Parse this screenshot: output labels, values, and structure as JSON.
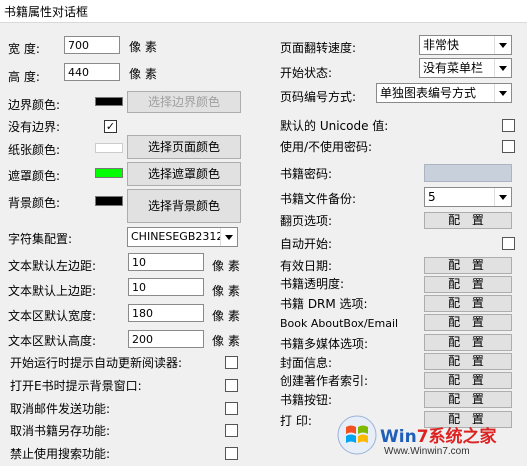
{
  "window_title": "书籍属性对话框",
  "left": {
    "width_label": "宽  度:",
    "width_value": "700",
    "width_unit": "像 素",
    "height_label": "高  度:",
    "height_value": "440",
    "height_unit": "像 素",
    "border_color_label": "边界颜色:",
    "border_color_button": "选择边界颜色",
    "no_border_label": "没有边界:",
    "no_border_checked": "✓",
    "paper_color_label": "纸张颜色:",
    "paper_color_button": "选择页面颜色",
    "mask_color_label": "遮罩颜色:",
    "mask_color_button": "选择遮罩颜色",
    "bg_color_label": "背景颜色:",
    "bg_color_button": "选择背景颜色",
    "charset_label": "字符集配置:",
    "charset_value": "CHINESEGB2312",
    "text_left_label": "文本默认左边距:",
    "text_left_value": "10",
    "text_top_label": "文本默认上边距:",
    "text_top_value": "10",
    "text_width_label": "文本区默认宽度:",
    "text_width_value": "180",
    "text_height_label": "文本区默认高度:",
    "text_height_value": "200",
    "px_unit": "像 素",
    "opt_auto_update": "开始运行时提示自动更新阅读器:",
    "opt_show_bg": "打开E书时提示背景窗口:",
    "opt_cancel_mail": "取消邮件发送功能:",
    "opt_cancel_saveas": "取消书籍另存功能:",
    "opt_disable_search": "禁止使用搜索功能:"
  },
  "right": {
    "flip_speed_label": "页面翻转速度:",
    "flip_speed_value": "非常快",
    "start_state_label": "开始状态:",
    "start_state_value": "没有菜单栏",
    "page_numbering_label": "页码编号方式:",
    "page_numbering_value": "单独图表编号方式",
    "unicode_label": "默认的 Unicode 值:",
    "use_password_label": "使用/不使用密码:",
    "password_label": "书籍密码:",
    "backup_label": "书籍文件备份:",
    "backup_value": "5",
    "flip_options_label": "翻页选项:",
    "autostart_label": "自动开始:",
    "expiry_label": "有效日期:",
    "transparency_label": "书籍透明度:",
    "drm_label": "书籍 DRM 选项:",
    "aboutbox_label": "Book AboutBox/Email",
    "multimedia_label": "书籍多媒体选项:",
    "cover_label": "封面信息:",
    "author_index_label": "创建著作者索引:",
    "buttons_label": "书籍按钮:",
    "print_label": "打 印:",
    "config_button": "配 置"
  },
  "colors": {
    "border": "#000000",
    "paper": "#ffffff",
    "mask": "#00ff00",
    "background": "#000000",
    "password_field": "#c8d0dc"
  },
  "watermark": {
    "brand": "Win7系统之家",
    "url": "Www.Winwin7.com"
  }
}
